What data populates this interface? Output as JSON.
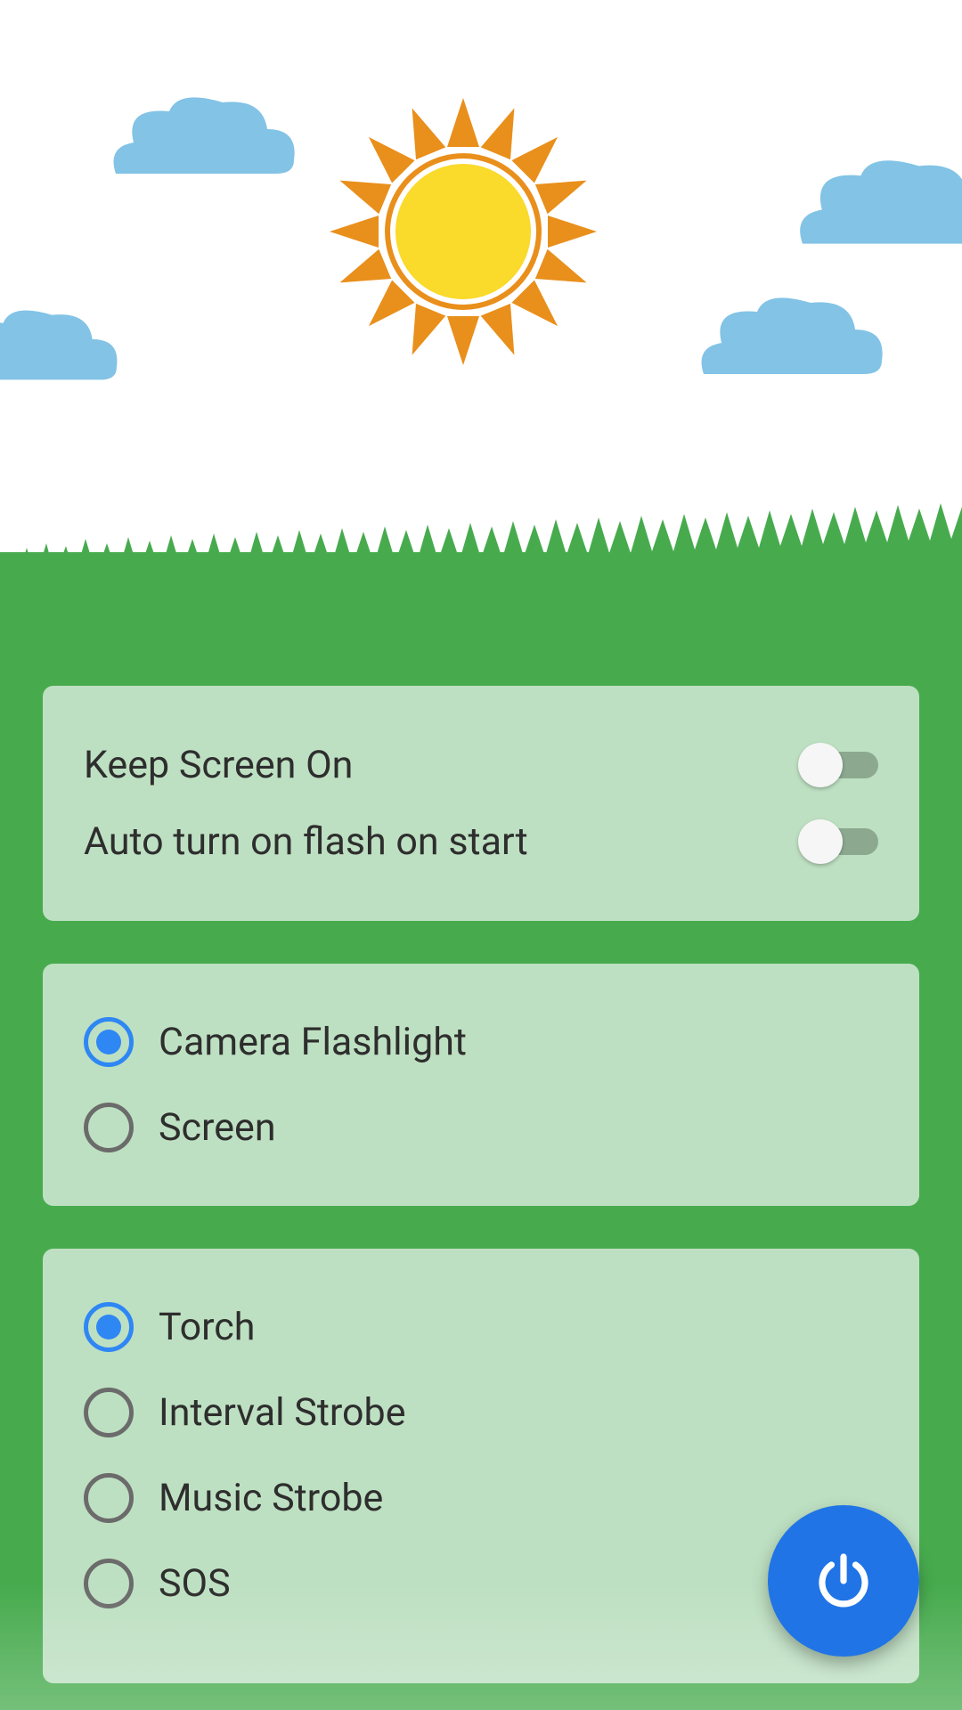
{
  "settings": {
    "keep_screen_on": {
      "label": "Keep Screen On",
      "checked": false
    },
    "auto_flash": {
      "label": "Auto turn on flash on start",
      "checked": false
    }
  },
  "light_source": {
    "camera": {
      "label": "Camera Flashlight",
      "selected": true
    },
    "screen": {
      "label": "Screen",
      "selected": false
    }
  },
  "mode": {
    "torch": {
      "label": "Torch",
      "selected": true
    },
    "interval": {
      "label": "Interval Strobe",
      "selected": false
    },
    "music": {
      "label": "Music Strobe",
      "selected": false
    },
    "sos": {
      "label": "SOS",
      "selected": false
    }
  },
  "icons": {
    "sun": "sun-icon",
    "cloud": "cloud-icon",
    "power": "power-icon"
  },
  "colors": {
    "accent": "#2074E6",
    "radio_selected": "#2F87F4",
    "grass": "#47AB4E",
    "card": "#BEE0C2",
    "cloud": "#82C3E6",
    "sun_core": "#FADA2A",
    "sun_ray": "#E98F1B"
  }
}
